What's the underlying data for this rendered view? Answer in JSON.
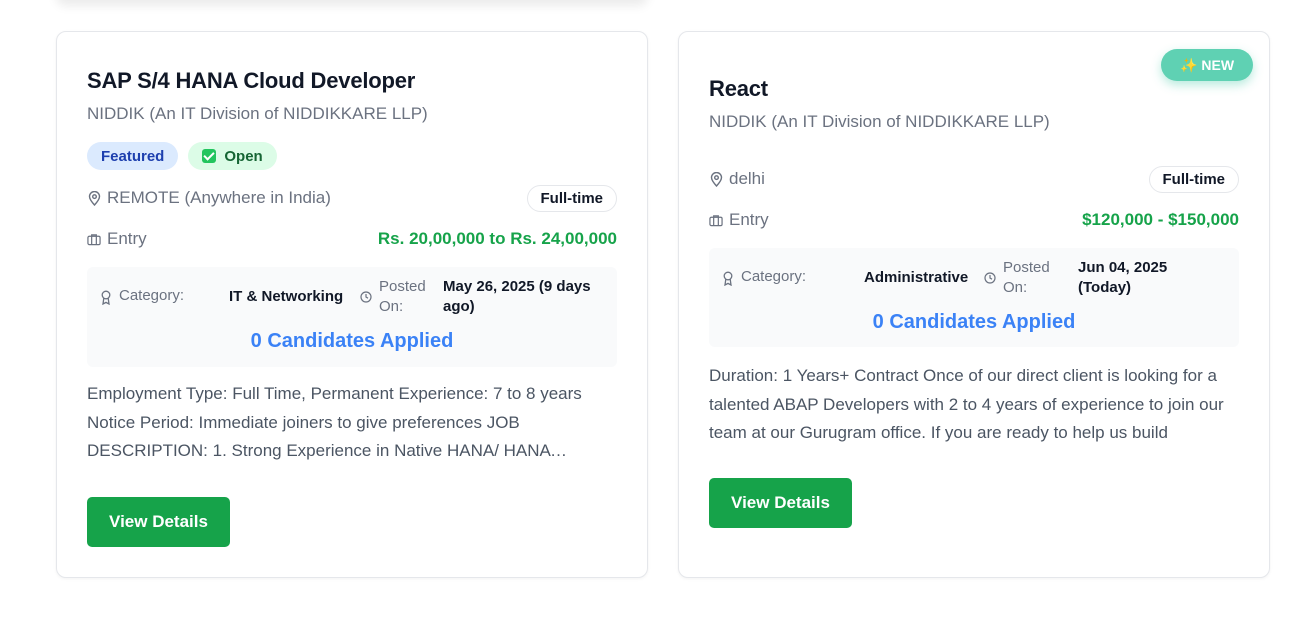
{
  "jobs": [
    {
      "title": "SAP S/4 HANA Cloud Developer",
      "company": "NIDDIK (An IT Division of NIDDIKKARE LLP)",
      "badges": {
        "featured": "Featured",
        "open": "Open"
      },
      "location": "REMOTE (Anywhere in India)",
      "job_type": "Full-time",
      "level": "Entry",
      "salary": "Rs. 20,00,000 to Rs. 24,00,000",
      "category_label": "Category:",
      "category": "IT & Networking",
      "posted_label_1": "Posted",
      "posted_label_2": "On:",
      "posted_1": "May 26, 2025 (9 days",
      "posted_2": "ago)",
      "applied": "0 Candidates Applied",
      "description": "Employment Type: Full Time, Permanent Experience: 7 to 8 years Notice Period: Immediate joiners to give preferences JOB DESCRIPTION: 1. Strong Experience in Native HANA/ HANA Modeling and development",
      "button": "View Details"
    },
    {
      "new_badge": "NEW",
      "title": "React",
      "company": "NIDDIK (An IT Division of NIDDIKKARE LLP)",
      "location": "delhi",
      "job_type": "Full-time",
      "level": "Entry",
      "salary": "$120,000 - $150,000",
      "category_label": "Category:",
      "category": "Administrative",
      "posted_label_1": "Posted",
      "posted_label_2": "On:",
      "posted_1": "Jun 04, 2025",
      "posted_2": "(Today)",
      "applied": "0 Candidates Applied",
      "description": "Duration: 1 Years+ Contract Once of our direct client is looking for a talented ABAP Developers with 2 to 4 years of experience to join our team at our Gurugram office. If you are ready to help us build",
      "button": "View Details"
    }
  ],
  "icons": {
    "location": "map-pin-icon",
    "level": "briefcase-icon",
    "category": "award-icon",
    "posted": "clock-icon",
    "open": "check-square-icon",
    "new": "sparkles-icon"
  },
  "colors": {
    "salary": "#16a34a",
    "applied": "#3b82f6",
    "button": "#16a34a",
    "featured_bg": "#dbeafe",
    "open_bg": "#dcfce7",
    "new_bg": "#5fd1b3"
  }
}
